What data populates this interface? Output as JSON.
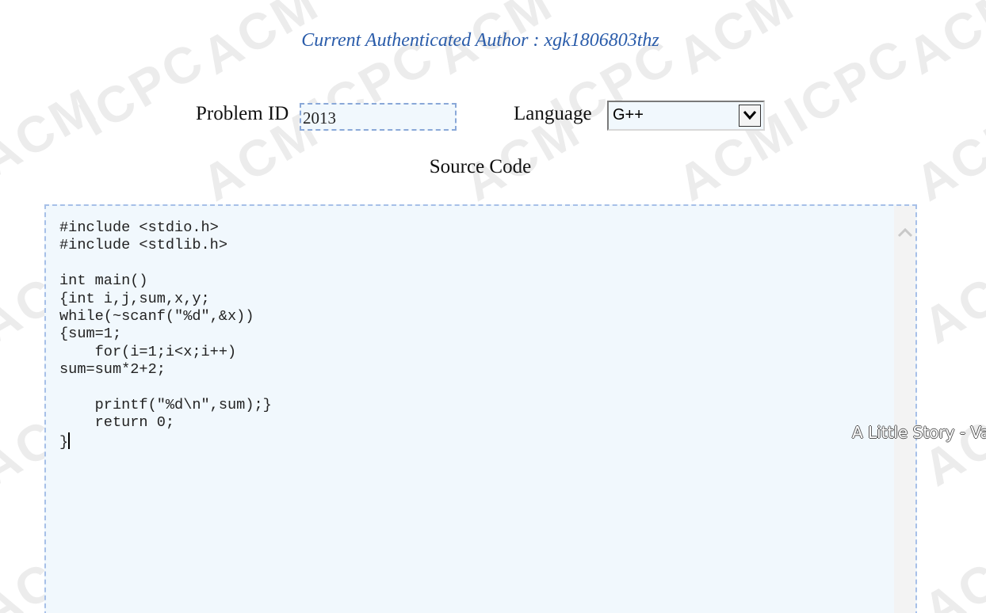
{
  "watermark": {
    "text_1": "ACM",
    "text_2": "ICPC"
  },
  "header": {
    "author_prefix": "Current Authenticated Author : ",
    "author_name": "xgk1806803thz"
  },
  "form": {
    "problem_id_label": "Problem ID",
    "problem_id_value": "2013",
    "language_label": "Language",
    "language_value": "G++",
    "source_code_label": "Source Code",
    "source_code": "#include <stdio.h>\n#include <stdlib.h>\n\nint main()\n{int i,j,sum,x,y;\nwhile(~scanf(\"%d\",&x))\n{sum=1;\n    for(i=1;i<x;i++)\nsum=sum*2+2;\n\n    printf(\"%d\\n\",sum);}\n    return 0;\n}"
  },
  "ticker": {
    "text": "A Little Story - Va"
  },
  "icons": {
    "dropdown": "chevron-down-icon",
    "scroll_up": "chevron-up-icon"
  },
  "colors": {
    "author_text": "#2a5caa",
    "input_background": "#f1f8fd",
    "input_border": "#8aa8d8"
  }
}
